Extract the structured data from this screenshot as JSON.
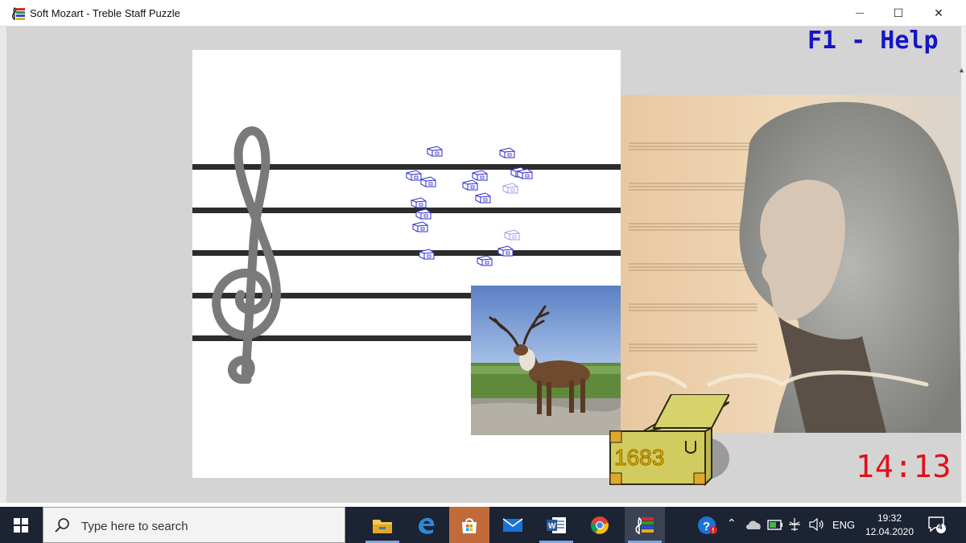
{
  "window": {
    "title": "Soft Mozart - Treble Staff Puzzle",
    "controls": {
      "minimize": "—",
      "maximize": "☐",
      "close": "✕"
    }
  },
  "game": {
    "help_label": "F1 - Help",
    "score": "1683",
    "timer": "14:13",
    "colors": {
      "help": "#1414c8",
      "timer": "#e0101a",
      "score": "#e6b800",
      "notes": "#2a2ad0"
    }
  },
  "taskbar": {
    "search_placeholder": "Type here to search",
    "apps": [
      {
        "name": "file-explorer-icon"
      },
      {
        "name": "edge-icon"
      },
      {
        "name": "store-icon"
      },
      {
        "name": "mail-icon"
      },
      {
        "name": "word-icon"
      },
      {
        "name": "chrome-icon"
      },
      {
        "name": "soft-mozart-icon"
      }
    ],
    "language": "ENG",
    "time": "19:32",
    "date": "12.04.2020",
    "notification_count": "4"
  }
}
